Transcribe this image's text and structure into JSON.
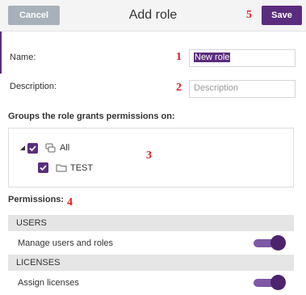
{
  "colors": {
    "accent": "#5b2c7e",
    "cancel": "#a8b1b9",
    "annotation": "#e02020",
    "selection": "#5b2c7e",
    "toggle_track": "#7e58a4",
    "toggle_knob": "#4c236c"
  },
  "header": {
    "cancel_label": "Cancel",
    "title": "Add role",
    "save_label": "Save"
  },
  "annotations": [
    "1",
    "2",
    "3",
    "4",
    "5"
  ],
  "form": {
    "name_label": "Name:",
    "name_value": "New role",
    "description_label": "Description:",
    "description_placeholder": "Description"
  },
  "groups": {
    "heading": "Groups the role grants permissions on:",
    "tree": [
      {
        "label": "All",
        "checked": true,
        "expanded": true,
        "icon": "group-icon"
      },
      {
        "label": "TEST",
        "checked": true,
        "icon": "folder-icon"
      }
    ]
  },
  "permissions": {
    "heading": "Permissions:",
    "sections": [
      {
        "title": "USERS",
        "items": [
          {
            "label": "Manage users and roles",
            "enabled": true
          }
        ]
      },
      {
        "title": "LICENSES",
        "items": [
          {
            "label": "Assign licenses",
            "enabled": true
          }
        ]
      }
    ]
  }
}
